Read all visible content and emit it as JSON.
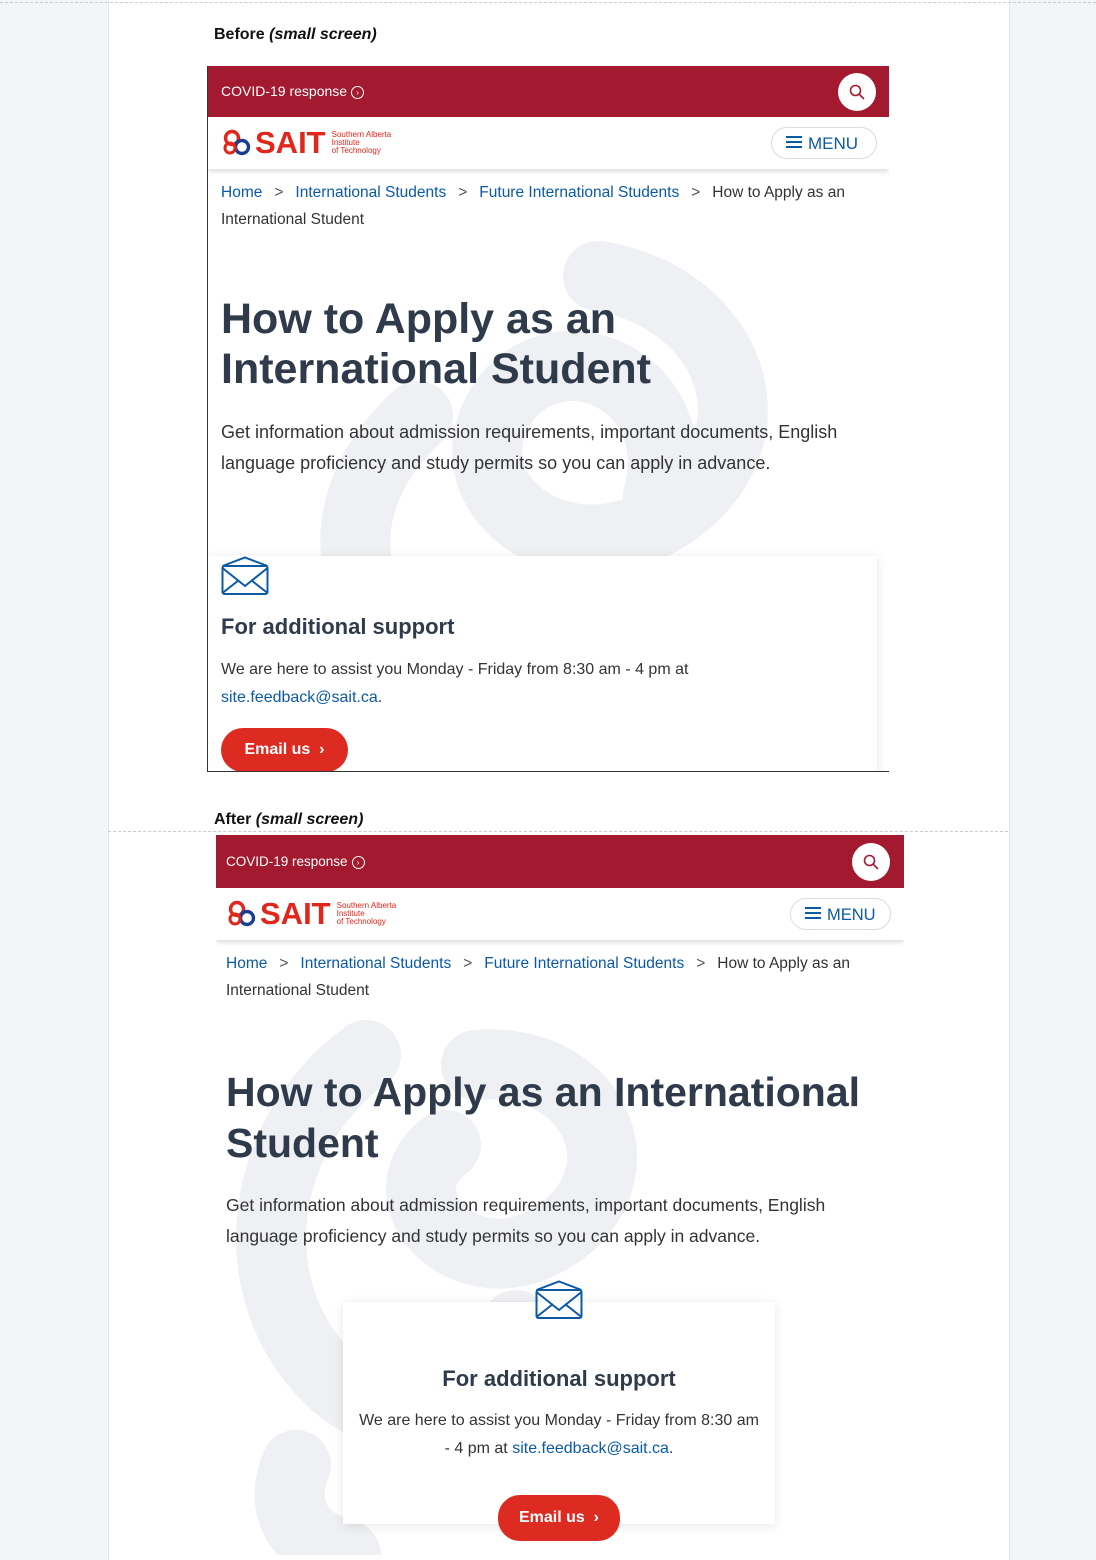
{
  "before": {
    "caption_label": "Before",
    "caption_note": "(small screen)",
    "covid_link": "COVID-19 response",
    "brand": {
      "name": "SAIT",
      "sub1": "Southern Alberta",
      "sub2": "Institute",
      "sub3": "of Technology"
    },
    "menu_label": "MENU",
    "breadcrumb": [
      "Home",
      "International Students",
      "Future International Students",
      "How to Apply as an International Student"
    ],
    "title": "How to Apply as an International Student",
    "lead": "Get information about admission requirements, important documents, English language proficiency and study permits so you can apply in advance.",
    "support": {
      "heading": "For additional support",
      "text": "We are here to assist you Monday - Friday from 8:30 am - 4 pm at",
      "email": "site.feedback@sait.ca",
      "button": "Email us"
    }
  },
  "after": {
    "caption_label": "After",
    "caption_note": "(small screen)",
    "covid_link": "COVID-19 response",
    "brand": {
      "name": "SAIT",
      "sub1": "Southern Alberta",
      "sub2": "Institute",
      "sub3": "of Technology"
    },
    "menu_label": "MENU",
    "breadcrumb": [
      "Home",
      "International Students",
      "Future International Students",
      "How to Apply as an International Student"
    ],
    "title": "How to Apply as an International Student",
    "lead": "Get information about admission requirements, important documents, English language proficiency and study permits so you can apply in advance.",
    "support": {
      "heading": "For additional support",
      "text": "We are here to assist you Monday - Friday from 8:30 am - 4 pm at",
      "email": "site.feedback@sait.ca",
      "button": "Email us"
    }
  },
  "colors": {
    "topbar": "#a3192f",
    "brand_red": "#e1261c",
    "link_blue": "#0b5aa6",
    "button_red": "#de2b21",
    "heading": "#2f3a4b"
  },
  "icons": {
    "covid": "arrow-circle-icon",
    "search": "search-icon",
    "menu": "hamburger-icon",
    "separator": "chevron-right-icon",
    "support": "envelope-icon",
    "button": "chevron-right-icon"
  }
}
